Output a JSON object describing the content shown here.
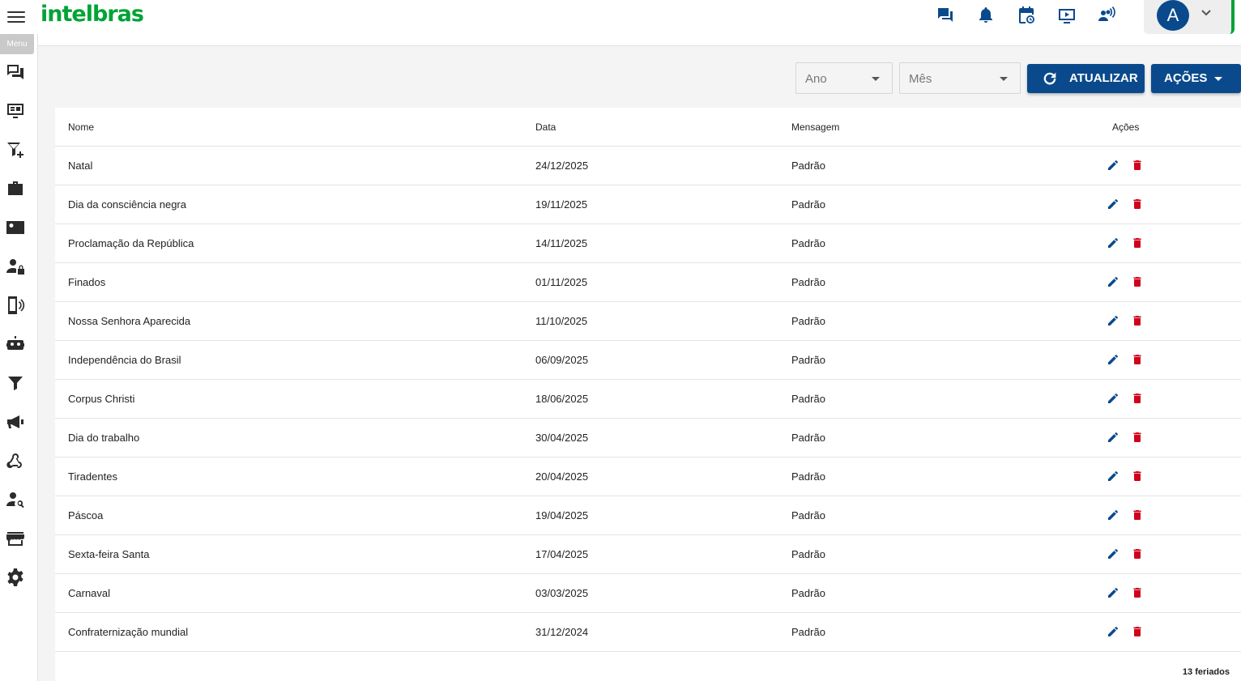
{
  "header": {
    "logo": "intelbras",
    "icons": [
      "chat-icon",
      "bell-icon",
      "calendar-clock-icon",
      "play-screen-icon",
      "people-voice-icon"
    ],
    "user_initial": "A"
  },
  "sidebar": {
    "menu_label": "Menu",
    "icons": [
      "chat-icon",
      "monitor-icon",
      "filter-add-icon",
      "briefcase-icon",
      "contact-card-icon",
      "user-lock-icon",
      "phone-broadcast-icon",
      "robot-icon",
      "filter-icon",
      "megaphone-icon",
      "webhook-icon",
      "user-search-icon",
      "store-icon",
      "gear-icon"
    ]
  },
  "filters": {
    "year_placeholder": "Ano",
    "month_placeholder": "Mês",
    "refresh_label": "ATUALIZAR",
    "actions_label": "AÇÕES"
  },
  "table": {
    "columns": {
      "name": "Nome",
      "date": "Data",
      "message": "Mensagem",
      "actions": "Ações"
    },
    "rows": [
      {
        "name": "Natal",
        "date": "24/12/2025",
        "message": "Padrão"
      },
      {
        "name": "Dia da consciência negra",
        "date": "19/11/2025",
        "message": "Padrão"
      },
      {
        "name": "Proclamação da República",
        "date": "14/11/2025",
        "message": "Padrão"
      },
      {
        "name": "Finados",
        "date": "01/11/2025",
        "message": "Padrão"
      },
      {
        "name": "Nossa Senhora Aparecida",
        "date": "11/10/2025",
        "message": "Padrão"
      },
      {
        "name": "Independência do Brasil",
        "date": "06/09/2025",
        "message": "Padrão"
      },
      {
        "name": "Corpus Christi",
        "date": "18/06/2025",
        "message": "Padrão"
      },
      {
        "name": "Dia do trabalho",
        "date": "30/04/2025",
        "message": "Padrão"
      },
      {
        "name": "Tiradentes",
        "date": "20/04/2025",
        "message": "Padrão"
      },
      {
        "name": "Páscoa",
        "date": "19/04/2025",
        "message": "Padrão"
      },
      {
        "name": "Sexta-feira Santa",
        "date": "17/04/2025",
        "message": "Padrão"
      },
      {
        "name": "Carnaval",
        "date": "03/03/2025",
        "message": "Padrão"
      },
      {
        "name": "Confraternização mundial",
        "date": "31/12/2024",
        "message": "Padrão"
      }
    ],
    "footer_count": "13 feriados"
  },
  "colors": {
    "brand_green": "#00a335",
    "primary_blue": "#0a4a8c",
    "delete_red": "#d0021b"
  }
}
